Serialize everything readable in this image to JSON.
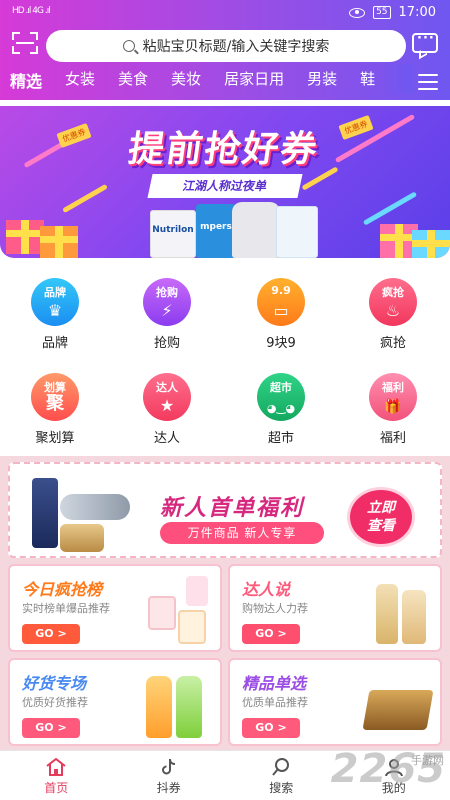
{
  "status_bar": {
    "signal": "HD .ıl 4G .ıl",
    "battery": "55",
    "time": "17:00"
  },
  "search": {
    "placeholder": "粘贴宝贝标题/输入关键字搜索"
  },
  "tabs": [
    "精选",
    "女装",
    "美食",
    "美妆",
    "居家日用",
    "男装",
    "鞋"
  ],
  "banner": {
    "title": "提前抢好券",
    "subtitle": "江湖人称过夜单",
    "tag_left": "优惠券",
    "tag_right": "优惠券",
    "product_label": "Nutrilon",
    "product_label_2": "mpers"
  },
  "categories": [
    {
      "label": "品牌",
      "icon_tag": "品牌",
      "icon_glyph": "♛",
      "icon": "crown-icon",
      "color1": "#33c8f8",
      "color2": "#1b8ef2"
    },
    {
      "label": "抢购",
      "icon_tag": "抢购",
      "icon_glyph": "⚡",
      "icon": "lightning-icon",
      "color1": "#c86af8",
      "color2": "#8b3cf0"
    },
    {
      "label": "9块9",
      "icon_tag": "9.9",
      "icon_glyph": "▭",
      "icon": "wallet-icon",
      "color1": "#ffb12e",
      "color2": "#ff7a1a"
    },
    {
      "label": "疯抢",
      "icon_tag": "疯抢",
      "icon_glyph": "♨",
      "icon": "fire-icon",
      "color1": "#ff6f8e",
      "color2": "#f2365c"
    },
    {
      "label": "聚划算",
      "icon_tag": "划算",
      "icon_glyph": "聚",
      "icon": "ju-icon",
      "color1": "#ff9a6a",
      "color2": "#ff4d4d"
    },
    {
      "label": "达人",
      "icon_tag": "达人",
      "icon_glyph": "★",
      "icon": "star-icon",
      "color1": "#ff6f8e",
      "color2": "#f23a5e"
    },
    {
      "label": "超市",
      "icon_tag": "超市",
      "icon_glyph": "◕‿◕",
      "icon": "cat-icon",
      "color1": "#2fd487",
      "color2": "#14a860"
    },
    {
      "label": "福利",
      "icon_tag": "福利",
      "icon_glyph": "🎁",
      "icon": "gift-icon",
      "color1": "#ff8fb0",
      "color2": "#f2527a"
    }
  ],
  "promo": {
    "title": "新人首单福利",
    "pill": "万件商品  新人专享",
    "button_line1": "立即",
    "button_line2": "查看"
  },
  "cards": [
    {
      "title": "今日疯抢榜",
      "sub": "实时榜单爆品推荐",
      "go": "GO >",
      "title_color": "#ff7a1a",
      "go_color": "#ff5a3c"
    },
    {
      "title": "达人说",
      "sub": "购物达人力荐",
      "go": "GO >",
      "title_color": "#ff5a7c",
      "go_color": "#ff4f6f"
    },
    {
      "title": "好货专场",
      "sub": "优质好货推荐",
      "go": "GO >",
      "title_color": "#4a8af0",
      "go_color": "#ff5a7c"
    },
    {
      "title": "精品单选",
      "sub": "优质单品推荐",
      "go": "GO >",
      "title_color": "#9b4ee5",
      "go_color": "#ff5a7c"
    }
  ],
  "bottom_nav": [
    {
      "label": "首页",
      "icon": "home-icon"
    },
    {
      "label": "抖券",
      "icon": "tiktok-icon"
    },
    {
      "label": "搜索",
      "icon": "search-icon"
    },
    {
      "label": "我的",
      "icon": "user-icon"
    }
  ],
  "watermark": {
    "main": "2265",
    "sub": "手游网"
  }
}
